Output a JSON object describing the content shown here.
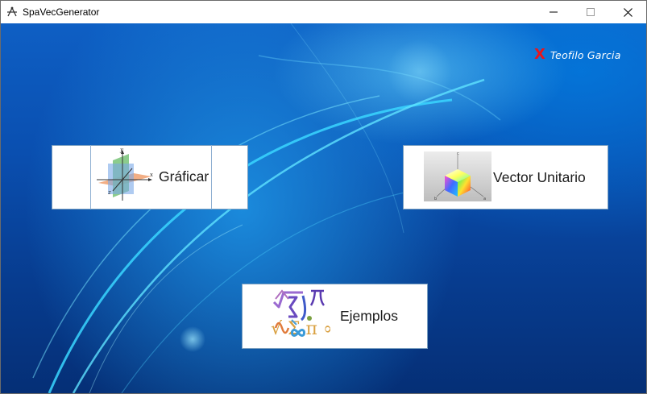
{
  "window": {
    "title": "SpaVecGenerator",
    "controls": [
      "minimize",
      "maximize",
      "close"
    ]
  },
  "author": {
    "close_glyph": "X",
    "name": "Teofilo Garcia",
    "mark_color": "#e8161c"
  },
  "buttons": {
    "graficar": {
      "label": "Gráficar",
      "icon": "3d-axes-planes-icon"
    },
    "vector_unitario": {
      "label": "Vector Unitario",
      "icon": "rgb-color-cube-icon"
    },
    "ejemplos": {
      "label": "Ejemplos",
      "icon": "math-symbols-icon"
    }
  },
  "icon_labels": {
    "axis_y": "y",
    "axis_x": "x",
    "axis_z": "z",
    "cube_c": "c",
    "cube_b": "b",
    "cube_a": "a",
    "math_symbols": "√ Σ π ∞"
  },
  "colors": {
    "background_blue": "#0a4fb0",
    "accent_cyan": "#4fd8ff",
    "button_border": "#7a9fc0"
  }
}
